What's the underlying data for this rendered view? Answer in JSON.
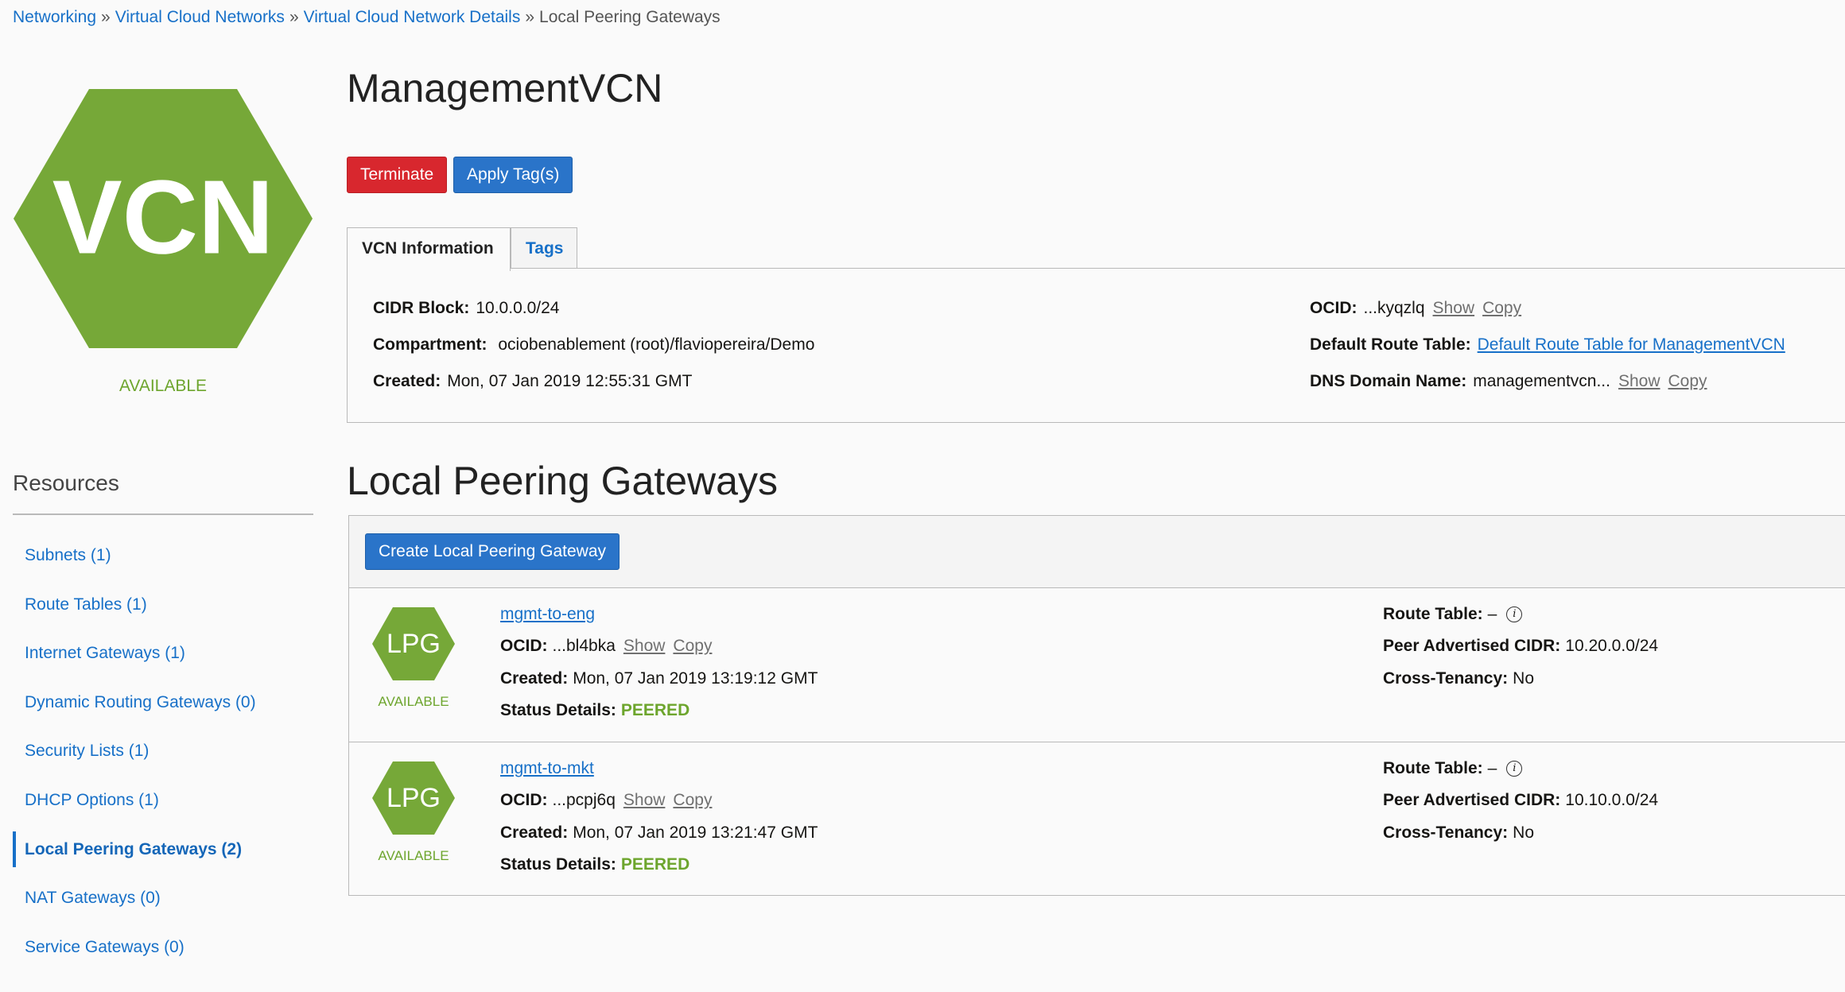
{
  "breadcrumb": {
    "items": [
      "Networking",
      "Virtual Cloud Networks",
      "Virtual Cloud Network Details"
    ],
    "current": "Local Peering Gateways",
    "separator": "»"
  },
  "vcn": {
    "icon_text": "VCN",
    "status": "AVAILABLE",
    "name": "ManagementVCN"
  },
  "actions": {
    "terminate_label": "Terminate",
    "apply_tags_label": "Apply Tag(s)"
  },
  "tabs": [
    {
      "label": "VCN Information",
      "active": true
    },
    {
      "label": "Tags",
      "active": false
    }
  ],
  "info": {
    "cidr_label": "CIDR Block:",
    "cidr_value": "10.0.0.0/24",
    "compartment_label": "Compartment:",
    "compartment_value": "ociobenablement (root)/flaviopereira/Demo",
    "created_label": "Created:",
    "created_value": "Mon, 07 Jan 2019 12:55:31 GMT",
    "ocid_label": "OCID:",
    "ocid_value": "...kyqzlq",
    "show_label": "Show",
    "copy_label": "Copy",
    "route_table_label": "Default Route Table:",
    "route_table_value": "Default Route Table for ManagementVCN",
    "dns_label": "DNS Domain Name:",
    "dns_value": "managementvcn..."
  },
  "resources": {
    "title": "Resources",
    "items": [
      {
        "label": "Subnets (1)",
        "active": false
      },
      {
        "label": "Route Tables (1)",
        "active": false
      },
      {
        "label": "Internet Gateways (1)",
        "active": false
      },
      {
        "label": "Dynamic Routing Gateways (0)",
        "active": false
      },
      {
        "label": "Security Lists (1)",
        "active": false
      },
      {
        "label": "DHCP Options (1)",
        "active": false
      },
      {
        "label": "Local Peering Gateways (2)",
        "active": true
      },
      {
        "label": "NAT Gateways (0)",
        "active": false
      },
      {
        "label": "Service Gateways (0)",
        "active": false
      }
    ]
  },
  "lpg_section": {
    "title": "Local Peering Gateways",
    "create_button": "Create Local Peering Gateway",
    "icon_text": "LPG",
    "labels": {
      "ocid": "OCID:",
      "created": "Created:",
      "status_details": "Status Details:",
      "route_table": "Route Table:",
      "peer_cidr": "Peer Advertised CIDR:",
      "cross_tenancy": "Cross-Tenancy:",
      "show": "Show",
      "copy": "Copy"
    },
    "gateways": [
      {
        "name": "mgmt-to-eng",
        "status": "AVAILABLE",
        "ocid": "...bl4bka",
        "created": "Mon, 07 Jan 2019 13:19:12 GMT",
        "status_details": "PEERED",
        "route_table": "–",
        "peer_cidr": "10.20.0.0/24",
        "cross_tenancy": "No"
      },
      {
        "name": "mgmt-to-mkt",
        "status": "AVAILABLE",
        "ocid": "...pcpj6q",
        "created": "Mon, 07 Jan 2019 13:21:47 GMT",
        "status_details": "PEERED",
        "route_table": "–",
        "peer_cidr": "10.10.0.0/24",
        "cross_tenancy": "No"
      }
    ]
  },
  "colors": {
    "brand_green": "#76a838",
    "link_blue": "#1770c8",
    "danger_red": "#d8272e",
    "primary_blue": "#2a74c9"
  }
}
